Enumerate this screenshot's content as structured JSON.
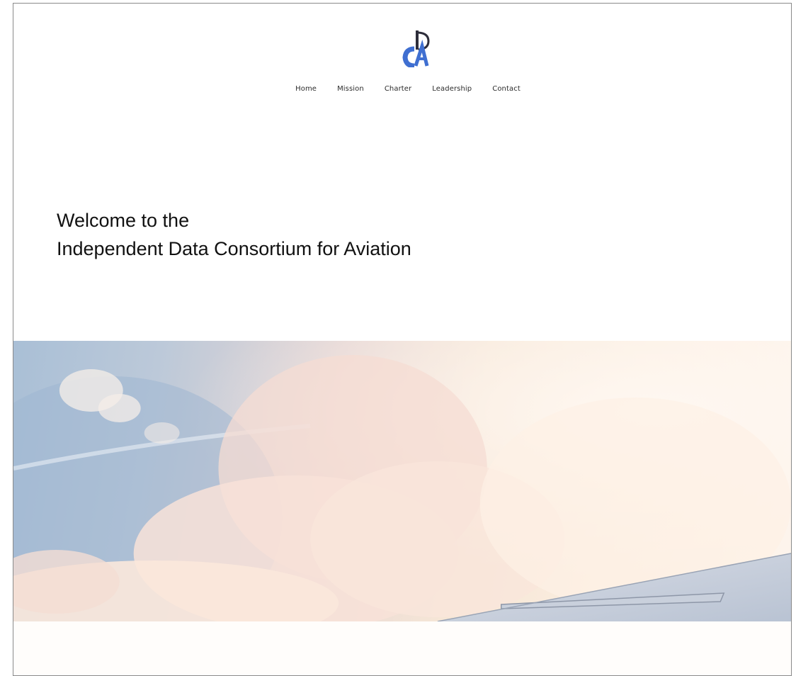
{
  "logo": {
    "icon": "idca-logo-icon",
    "letters": "IDCA",
    "color": "#3f6fd1"
  },
  "nav": {
    "items": [
      {
        "label": "Home"
      },
      {
        "label": "Mission"
      },
      {
        "label": "Charter"
      },
      {
        "label": "Leadership"
      },
      {
        "label": "Contact"
      }
    ]
  },
  "hero": {
    "line1": "Welcome to the",
    "line2": "Independent Data Consortium for Aviation"
  },
  "banner": {
    "image": "sky-clouds-airplane-wing-image"
  }
}
